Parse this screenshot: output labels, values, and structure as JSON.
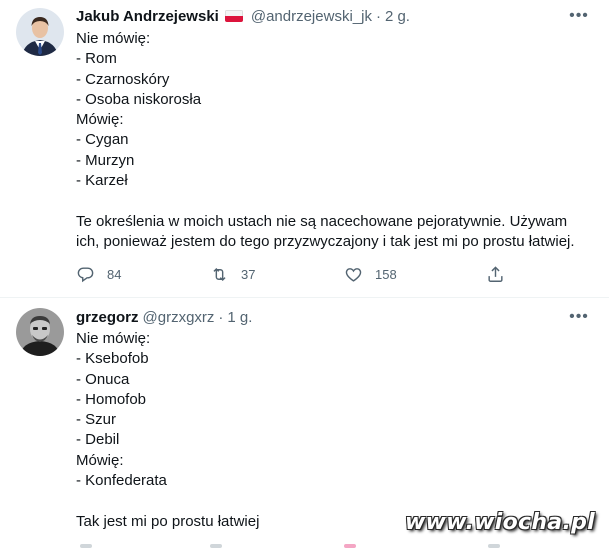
{
  "tweets": [
    {
      "name": "Jakub Andrzejewski",
      "handle": "@andrzejewski_jk",
      "separator": "·",
      "time": "2 g.",
      "lines": [
        "Nie mówię:",
        "- Rom",
        "- Czarnoskóry",
        "- Osoba niskorosła",
        "Mówię:",
        "- Cygan",
        "- Murzyn",
        "- Karzeł",
        "",
        "Te określenia w moich ustach nie są nacechowane pejoratywnie. Używam",
        "ich, ponieważ jestem do tego przyzwyczajony i tak jest mi po prostu łatwiej."
      ],
      "replies": "84",
      "retweets": "37",
      "likes": "158"
    },
    {
      "name": "grzegorz",
      "handle": "@grzxgxrz",
      "separator": "·",
      "time": "1 g.",
      "lines": [
        "Nie mówię:",
        "- Ksebofob",
        "- Onuca",
        "- Homofob",
        "- Szur",
        "- Debil",
        "Mówię:",
        "- Konfederata",
        "",
        "Tak jest mi po prostu łatwiej"
      ]
    }
  ],
  "more_icon": "more-horizontal-icon",
  "colors": {
    "text": "#0f1419",
    "muted": "#536471",
    "divider": "#eff3f4"
  },
  "watermark": "www.wiocha.pl"
}
